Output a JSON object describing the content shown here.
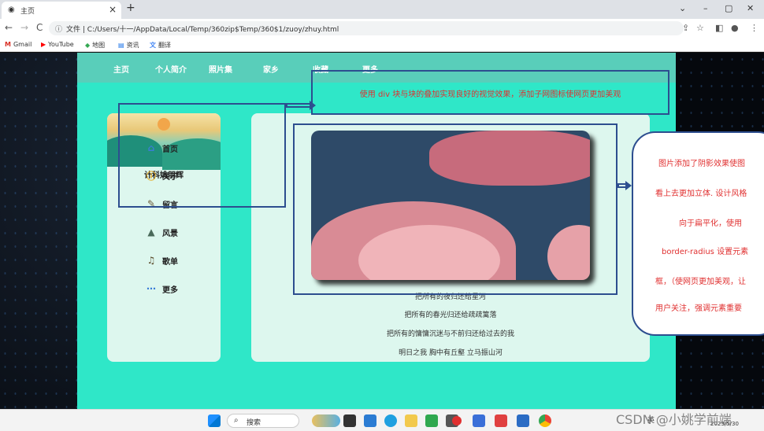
{
  "browser": {
    "tab_title": "主页",
    "tab_close": "×",
    "new_tab": "+",
    "window_controls": [
      "⌄",
      "–",
      "▢",
      "✕"
    ],
    "nav": {
      "back": "←",
      "forward": "→",
      "reload": "C"
    },
    "address_prefix": "文件",
    "url": "C:/Users/十一/AppData/Local/Temp/360zip$Temp/360$1/zuoy/zhuy.html",
    "bookmarks": [
      {
        "icon": "gmail-icon",
        "glyph": "M",
        "color": "#d93025",
        "label": "Gmail"
      },
      {
        "icon": "youtube-icon",
        "glyph": "▶",
        "color": "#ff0000",
        "label": "YouTube"
      },
      {
        "icon": "maps-icon",
        "glyph": "◆",
        "color": "#34a853",
        "label": "地图"
      },
      {
        "icon": "news-icon",
        "glyph": "▤",
        "color": "#1a73e8",
        "label": "资讯"
      },
      {
        "icon": "translate-icon",
        "glyph": "文",
        "color": "#4285f4",
        "label": "翻译"
      }
    ]
  },
  "site": {
    "nav_items": [
      "主页",
      "个人简介",
      "照片集",
      "家乡",
      "收藏",
      "更多"
    ],
    "sidebar": {
      "name": "计科姚朋辉",
      "menu": [
        {
          "icon": "home-icon",
          "glyph": "⌂",
          "color": "#3b7dd8",
          "label": "首页"
        },
        {
          "icon": "info-icon",
          "glyph": "ⓘ",
          "color": "#e6a817",
          "label": "关于"
        },
        {
          "icon": "message-icon",
          "glyph": "✎",
          "color": "#6a5a3a",
          "label": "留言"
        },
        {
          "icon": "landscape-icon",
          "glyph": "▲",
          "color": "#4a6a5a",
          "label": "风景"
        },
        {
          "icon": "song-icon",
          "glyph": "♫",
          "color": "#5a4a2a",
          "label": "歌单"
        },
        {
          "icon": "more-icon",
          "glyph": "⋯",
          "color": "#3b7dd8",
          "label": "更多"
        }
      ]
    },
    "poem": [
      "把所有的夜归还给星河",
      "把所有的春光归还给疏疏篱落",
      "把所有的慵慵沉迷与不前归还给过去的我",
      "明日之我 胸中有丘壑 立马振山河"
    ]
  },
  "annotations": {
    "top_note": "使用 div 块与块的叠加实现良好的视觉效果，添加子网图标使网页更加美观",
    "right_note_lines": [
      "图片添加了阴影效果使图",
      "看上去更加立体. 设计风格",
      "向于扁平化，使用",
      "border-radius 设置元素",
      "框，（使网页更加美观，让",
      "用户关注，强调元素重要"
    ]
  },
  "taskbar": {
    "search_label": "搜索",
    "tray_text": "英",
    "date": "2023/5/30"
  },
  "watermark": "CSDN @小姚学前端"
}
